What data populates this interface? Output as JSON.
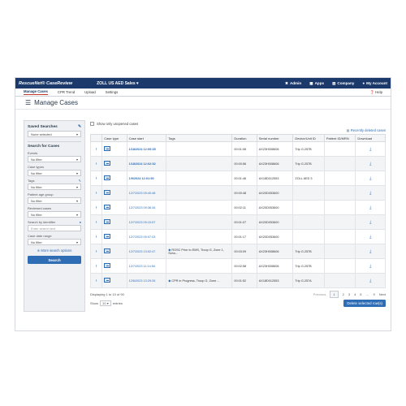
{
  "app": {
    "brand": "RescueNet® CaseReview",
    "org": "ZOLL US AED Sales ▾"
  },
  "topnav": [
    {
      "icon": "tools-icon",
      "label": "Admin"
    },
    {
      "icon": "apps-icon",
      "label": "Apps"
    },
    {
      "icon": "building-icon",
      "label": "Company"
    },
    {
      "icon": "user-icon",
      "label": "My Account"
    }
  ],
  "subnav": [
    "Manage Cases",
    "CPR Trend",
    "Upload",
    "Settings"
  ],
  "help": "Help",
  "page_title": "Manage Cases",
  "left": {
    "saved_searches": "Saved Searches",
    "saved_value": "None selected",
    "search_for_cases": "Search for Cases",
    "filters": [
      {
        "label": "Events",
        "value": "No filter"
      },
      {
        "label": "Case types",
        "value": "No filter"
      },
      {
        "label": "Tags",
        "value": "No filter"
      },
      {
        "label": "Patient age group",
        "value": "No filter"
      },
      {
        "label": "Reviewed cases",
        "value": "No filter"
      }
    ],
    "identifier_label": "Search by identifier",
    "identifier_placeholder": "Enter search text",
    "date_label": "Case date range",
    "date_value": "No filter",
    "more_options": "More search options",
    "search_button": "Search"
  },
  "main": {
    "unopened_label": "Show only unopened cases",
    "recently_deleted": "Recently deleted cases",
    "columns": [
      "",
      "Case type",
      "Case start",
      "Tags",
      "Duration",
      "Serial number",
      "Device/Unit ID",
      "Patient ID/MRN",
      "Download"
    ],
    "rows": [
      {
        "start": "1/18/2024 12:09:35",
        "tags": "",
        "duration": "00:01:08",
        "serial": "AX23H008606",
        "device": "Trip G.257B",
        "bold": true
      },
      {
        "start": "1/18/2024 12:02:52",
        "tags": "",
        "duration": "00:00:56",
        "serial": "AX23H008606",
        "device": "Trip G.257B",
        "bold": true
      },
      {
        "start": "1/9/2024 12:01:50",
        "tags": "",
        "duration": "00:01:46",
        "serial": "AX18D012553",
        "device": "ZOLL AED 3",
        "bold": true
      },
      {
        "start": "12/7/2023 09:40:48",
        "tags": "",
        "duration": "00:00:48",
        "serial": "AX20D053600",
        "device": "",
        "bold": false
      },
      {
        "start": "12/7/2023 09:36:34",
        "tags": "",
        "duration": "00:02:11",
        "serial": "AX20D053600",
        "device": "",
        "bold": false
      },
      {
        "start": "12/7/2023 09:10:57",
        "tags": "",
        "duration": "00:01:07",
        "serial": "AX20D053600",
        "device": "",
        "bold": false
      },
      {
        "start": "12/7/2023 09:07:03",
        "tags": "",
        "duration": "00:01:17",
        "serial": "AX20D053600",
        "device": "",
        "bold": false
      },
      {
        "start": "12/7/2023 13:02:47",
        "tags": "ROSC Prior to EMS, Troop G, Zone 1, Scho...",
        "duration": "00:03:09",
        "serial": "AX23H008606",
        "device": "Trip G.257B",
        "bold": false
      },
      {
        "start": "12/7/2023 11:14:54",
        "tags": "",
        "duration": "00:02:58",
        "serial": "AX23H008606",
        "device": "Trip G.257B",
        "bold": false
      },
      {
        "start": "12/6/2023 13:29:26",
        "tags": "CPR in Progress, Troop G, Zone ...",
        "duration": "00:01:52",
        "serial": "AX18D012553",
        "device": "Trip G.257A",
        "bold": false
      }
    ],
    "displaying": "Displaying 1 to 10 of 90",
    "pager": {
      "previous": "Previous",
      "pages": [
        "1",
        "2",
        "3",
        "4",
        "5",
        "…",
        "9"
      ],
      "next": "Next"
    },
    "show_label": "Show",
    "show_value": "10",
    "entries_label": "entries",
    "delete_button": "Delete selected row(s)"
  }
}
